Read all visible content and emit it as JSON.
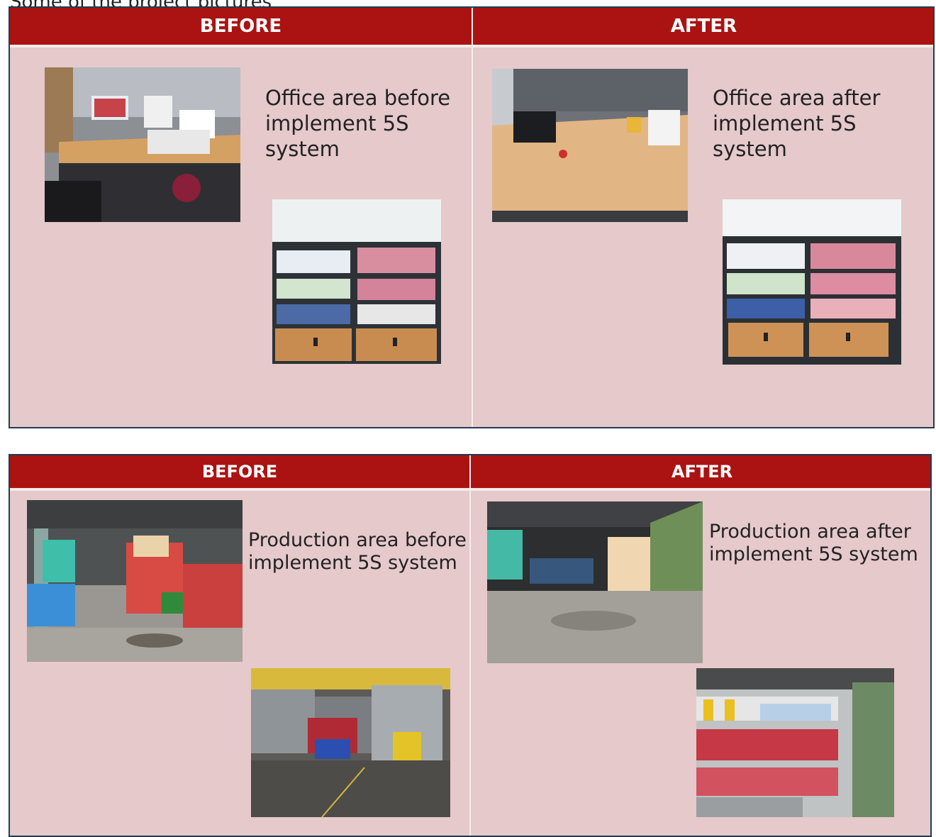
{
  "caption": "Some of the project pictures",
  "panels": [
    {
      "before_label": "BEFORE",
      "after_label": "AFTER",
      "before_text": "Office area before implement 5S system",
      "after_text": "Office area after implement 5S system"
    },
    {
      "before_label": "BEFORE",
      "after_label": "AFTER",
      "before_text": "Production area before implement 5S system",
      "after_text": "Production area after implement 5S system"
    }
  ]
}
